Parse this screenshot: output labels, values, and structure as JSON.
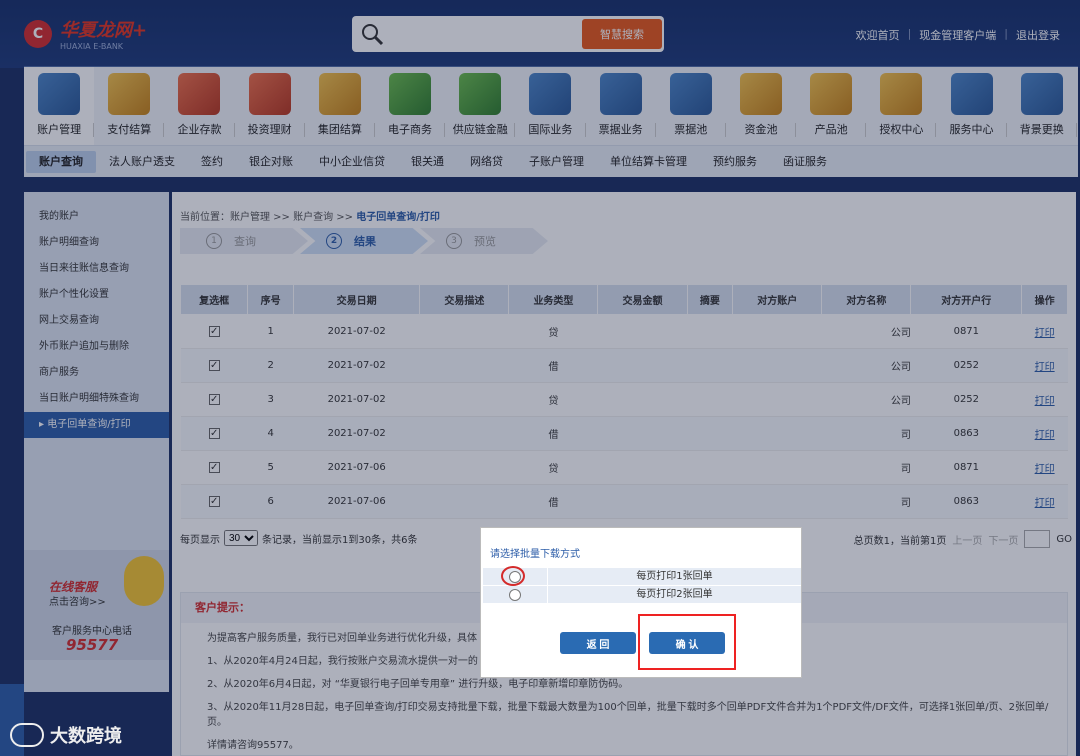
{
  "header": {
    "logo_mark": "C",
    "logo_brand": "华夏龙网+",
    "logo_sub": "HUAXIA E-BANK",
    "search_button": "智慧搜索",
    "links": [
      "欢迎首页",
      "现金管理客户端",
      "退出登录"
    ]
  },
  "nav": [
    {
      "label": "账户管理",
      "icon": "account-management-icon"
    },
    {
      "label": "支付结算",
      "icon": "payment-icon"
    },
    {
      "label": "企业存款",
      "icon": "deposit-icon"
    },
    {
      "label": "投资理财",
      "icon": "investment-icon"
    },
    {
      "label": "集团结算",
      "icon": "group-settlement-icon"
    },
    {
      "label": "电子商务",
      "icon": "ecommerce-icon"
    },
    {
      "label": "供应链金融",
      "icon": "supply-chain-icon"
    },
    {
      "label": "国际业务",
      "icon": "international-icon"
    },
    {
      "label": "票据业务",
      "icon": "bill-icon"
    },
    {
      "label": "票据池",
      "icon": "bill-pool-icon"
    },
    {
      "label": "资金池",
      "icon": "fund-pool-icon"
    },
    {
      "label": "产品池",
      "icon": "product-pool-icon"
    },
    {
      "label": "授权中心",
      "icon": "auth-center-icon"
    },
    {
      "label": "服务中心",
      "icon": "service-center-icon"
    },
    {
      "label": "背景更换",
      "icon": "theme-icon"
    }
  ],
  "subnav": [
    "账户查询",
    "法人账户透支",
    "签约",
    "银企对账",
    "中小企业信贷",
    "银关通",
    "网络贷",
    "子账户管理",
    "单位结算卡管理",
    "预约服务",
    "函证服务"
  ],
  "sidebar": [
    "我的账户",
    "账户明细查询",
    "当日来往账信息查询",
    "账户个性化设置",
    "网上交易查询",
    "外币账户追加与删除",
    "商户服务",
    "当日账户明细特殊查询",
    "▸ 电子回单查询/打印"
  ],
  "help": {
    "title": "在线客服",
    "link": "点击咨询>>",
    "phone_label": "客户服务中心电话",
    "phone": "95577"
  },
  "breadcrumb": {
    "prefix": "当前位置：账户管理 >> 账户查询 >> ",
    "current": "电子回单查询/打印"
  },
  "steps": [
    {
      "num": "1",
      "label": "查询"
    },
    {
      "num": "2",
      "label": "结果"
    },
    {
      "num": "3",
      "label": "预览"
    }
  ],
  "table": {
    "headers": [
      "复选框",
      "序号",
      "交易日期",
      "交易描述",
      "业务类型",
      "交易金额",
      "摘要",
      "对方账户",
      "对方名称",
      "对方开户行",
      "操作"
    ],
    "rows": [
      {
        "checked": "✓",
        "no": "1",
        "date": "2021-07-02",
        "type": "贷",
        "name": "公司",
        "bank": "0871",
        "action": "打印"
      },
      {
        "checked": "✓",
        "no": "2",
        "date": "2021-07-02",
        "type": "借",
        "name": "公司",
        "bank": "0252",
        "action": "打印"
      },
      {
        "checked": "✓",
        "no": "3",
        "date": "2021-07-02",
        "type": "贷",
        "name": "公司",
        "bank": "0252",
        "action": "打印"
      },
      {
        "checked": "✓",
        "no": "4",
        "date": "2021-07-02",
        "type": "借",
        "name": "司",
        "bank": "0863",
        "action": "打印"
      },
      {
        "checked": "✓",
        "no": "5",
        "date": "2021-07-06",
        "type": "贷",
        "name": "司",
        "bank": "0871",
        "action": "打印"
      },
      {
        "checked": "✓",
        "no": "6",
        "date": "2021-07-06",
        "type": "借",
        "name": "司",
        "bank": "0863",
        "action": "打印"
      }
    ]
  },
  "pager": {
    "prefix": "每页显示",
    "size": "30",
    "suffix": "条记录，当前显示1到30条，共6条",
    "total": "总页数1，当前第1页",
    "prev": "上一页",
    "next": "下一页",
    "go": "GO"
  },
  "tips": {
    "title": "客户提示：",
    "lines": [
      "为提高客户服务质量，我行已对回单业务进行优化升级，具体",
      "1、从2020年4月24日起，我行按账户交易流水提供一对一的",
      "2、从2020年6月4日起，对 “华夏银行电子回单专用章” 进行升级，电子印章新增印章防伪码。",
      "3、从2020年11月28日起，电子回单查询/打印交易支持批量下载，批量下载最大数量为100个回单，批量下载时多个回单PDF文件合并为1个PDF文件/DF文件，可选择1张回单/页、2张回单/页。",
      "详情请咨询95577。"
    ]
  },
  "dialog": {
    "title": "请选择批量下载方式",
    "options": [
      "每页打印1张回单",
      "每页打印2张回单"
    ],
    "back": "返 回",
    "confirm": "确 认"
  },
  "watermark": "大数跨境"
}
